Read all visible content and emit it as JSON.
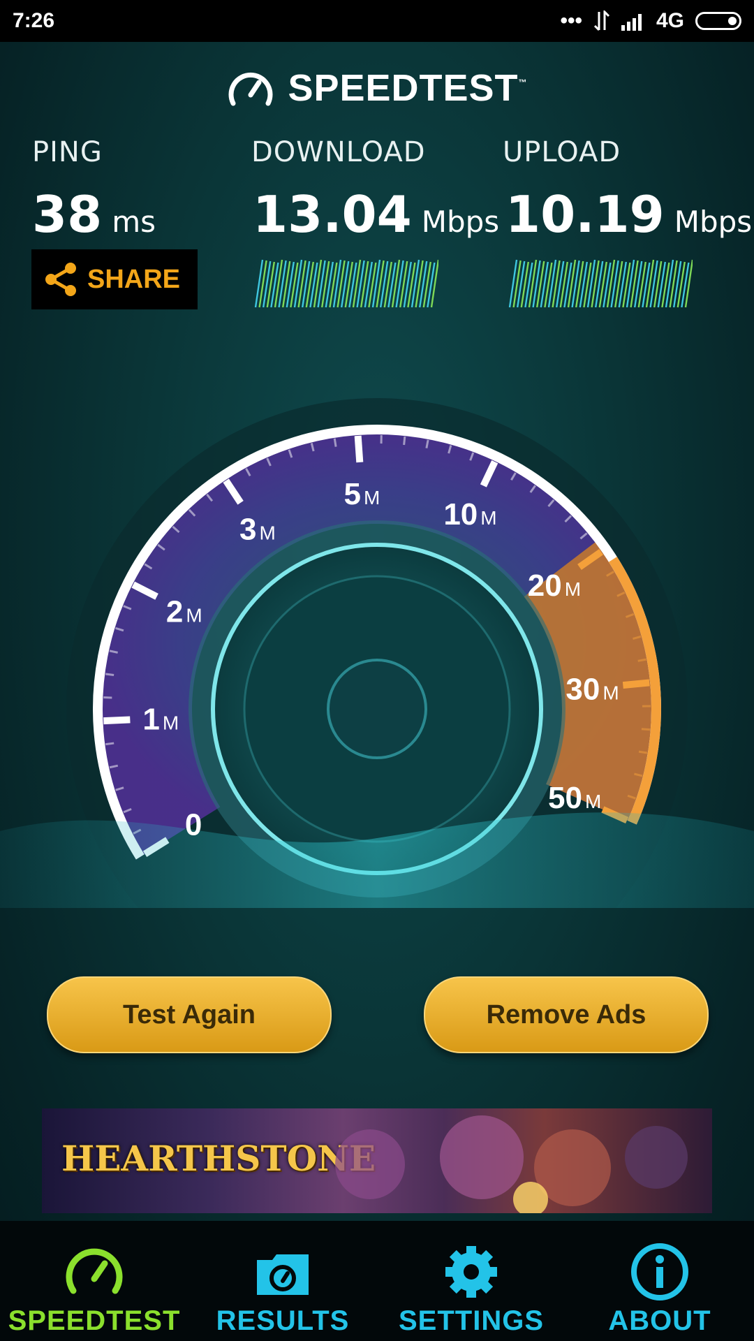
{
  "status_bar": {
    "time": "7:26",
    "network": "4G",
    "dots": "•••"
  },
  "header": {
    "title": "SPEEDTEST",
    "tm": "™"
  },
  "metrics": {
    "ping": {
      "label": "PING",
      "value": "38",
      "unit": "ms"
    },
    "download": {
      "label": "DOWNLOAD",
      "value": "13.04",
      "unit": "Mbps"
    },
    "upload": {
      "label": "UPLOAD",
      "value": "10.19",
      "unit": "Mbps"
    }
  },
  "share": {
    "label": "SHARE"
  },
  "gauge": {
    "labels": [
      {
        "num": "0",
        "unit": ""
      },
      {
        "num": "1",
        "unit": "M"
      },
      {
        "num": "2",
        "unit": "M"
      },
      {
        "num": "3",
        "unit": "M"
      },
      {
        "num": "5",
        "unit": "M"
      },
      {
        "num": "10",
        "unit": "M"
      },
      {
        "num": "20",
        "unit": "M"
      },
      {
        "num": "30",
        "unit": "M"
      },
      {
        "num": "50",
        "unit": "M"
      }
    ]
  },
  "buttons": {
    "test_again": "Test Again",
    "remove_ads": "Remove Ads"
  },
  "ad": {
    "text": "HEARTHSTONE"
  },
  "nav": [
    {
      "label": "SPEEDTEST",
      "icon": "speedometer-icon",
      "color": "#8be02d"
    },
    {
      "label": "RESULTS",
      "icon": "results-folder-icon",
      "color": "#23c3e8"
    },
    {
      "label": "SETTINGS",
      "icon": "gear-icon",
      "color": "#23c3e8"
    },
    {
      "label": "ABOUT",
      "icon": "info-icon",
      "color": "#23c3e8"
    }
  ],
  "colors": {
    "accent_orange": "#f3a619",
    "nav_active": "#8be02d",
    "nav_inactive": "#23c3e8"
  }
}
